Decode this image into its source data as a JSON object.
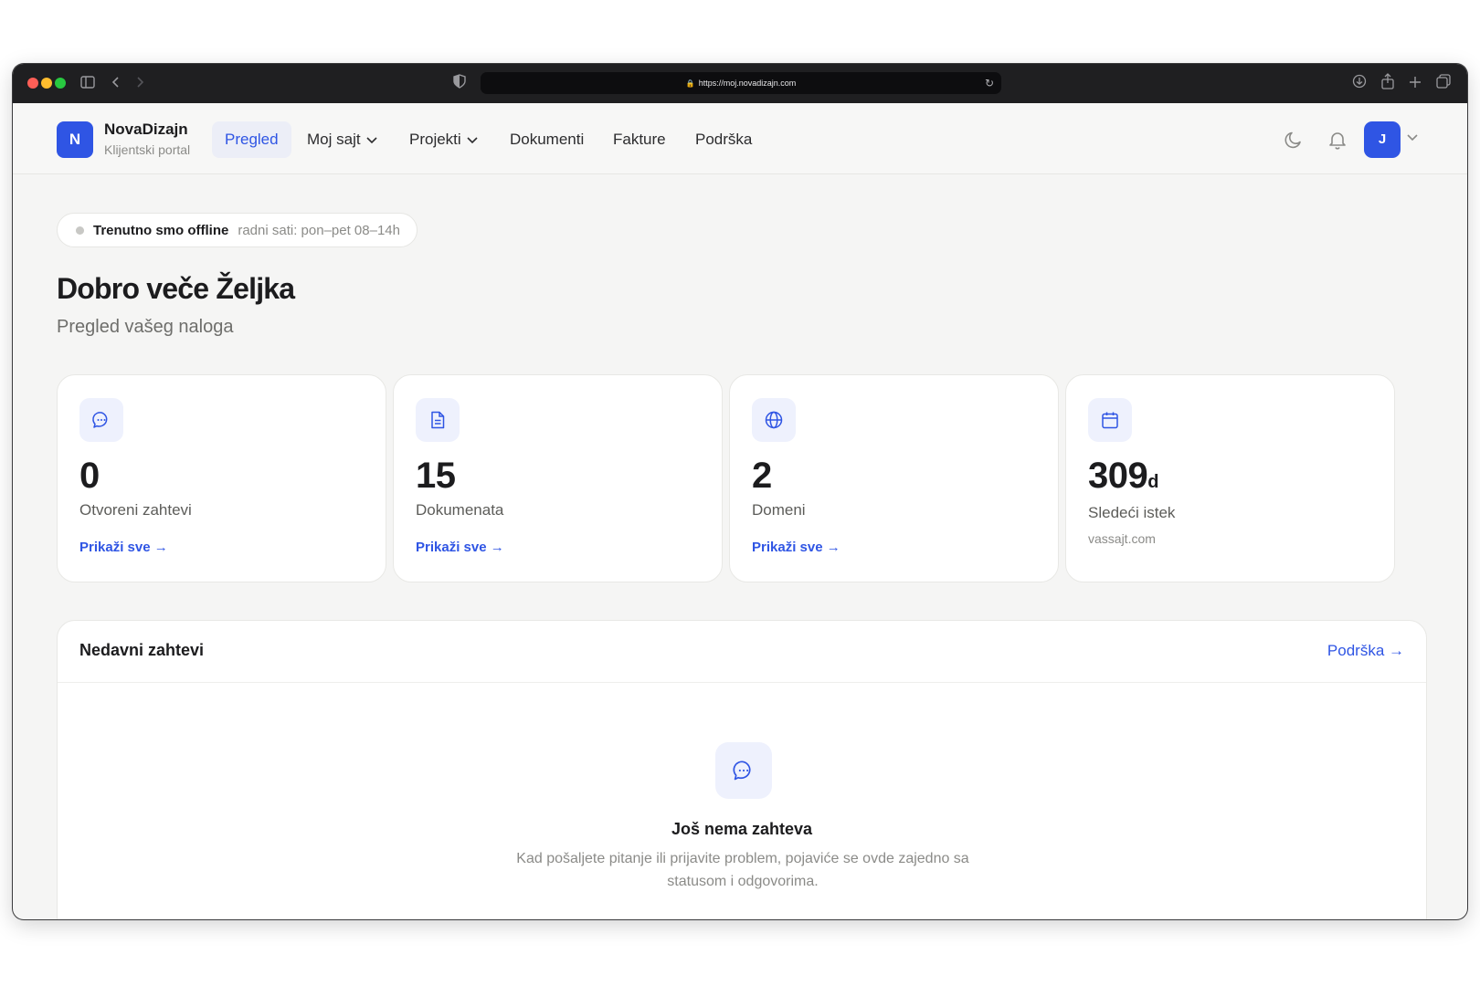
{
  "browser": {
    "url": "https://moj.novadizajn.com",
    "colors": {
      "close": "#ff5f57",
      "minimize": "#febc2e",
      "zoom": "#28c840"
    }
  },
  "brand": {
    "initial": "N",
    "name": "NovaDizajn",
    "subtitle": "Klijentski portal"
  },
  "nav": {
    "items": [
      {
        "label": "Pregled",
        "active": true
      },
      {
        "label": "Moj sajt",
        "dropdown": true
      },
      {
        "label": "Projekti",
        "dropdown": true
      },
      {
        "label": "Dokumenti"
      },
      {
        "label": "Fakture"
      },
      {
        "label": "Podrška"
      }
    ],
    "icons": [
      "moon-icon",
      "bell-icon"
    ],
    "avatar_initial": "J"
  },
  "status": {
    "title": "Trenutno smo offline",
    "hours": "radni sati: pon–pet 08–14h"
  },
  "greeting": {
    "title": "Dobro veče Željka",
    "subtitle": "Pregled vašeg naloga"
  },
  "cards": [
    {
      "icon": "chat-icon",
      "value": "0",
      "label": "Otvoreni zahtevi",
      "link": "Prikaži sve →"
    },
    {
      "icon": "document-icon",
      "value": "15",
      "label": "Dokumenata",
      "link": "Prikaži sve →"
    },
    {
      "icon": "globe-icon",
      "value": "2",
      "label": "Domeni",
      "link": "Prikaži sve →"
    },
    {
      "icon": "calendar-icon",
      "value": "309",
      "unit": "d",
      "label": "Sledeći istek",
      "sub": "vassajt.com"
    }
  ],
  "recent": {
    "title": "Nedavni zahtevi",
    "link": "Podrška →",
    "empty_title": "Još nema zahteva",
    "empty_desc": "Kad pošaljete pitanje ili prijavite problem, pojaviće se ovde zajedno sa statusom i odgovorima."
  },
  "colors": {
    "accent": "#2f55e4",
    "icon_bg": "#eef1fd"
  }
}
